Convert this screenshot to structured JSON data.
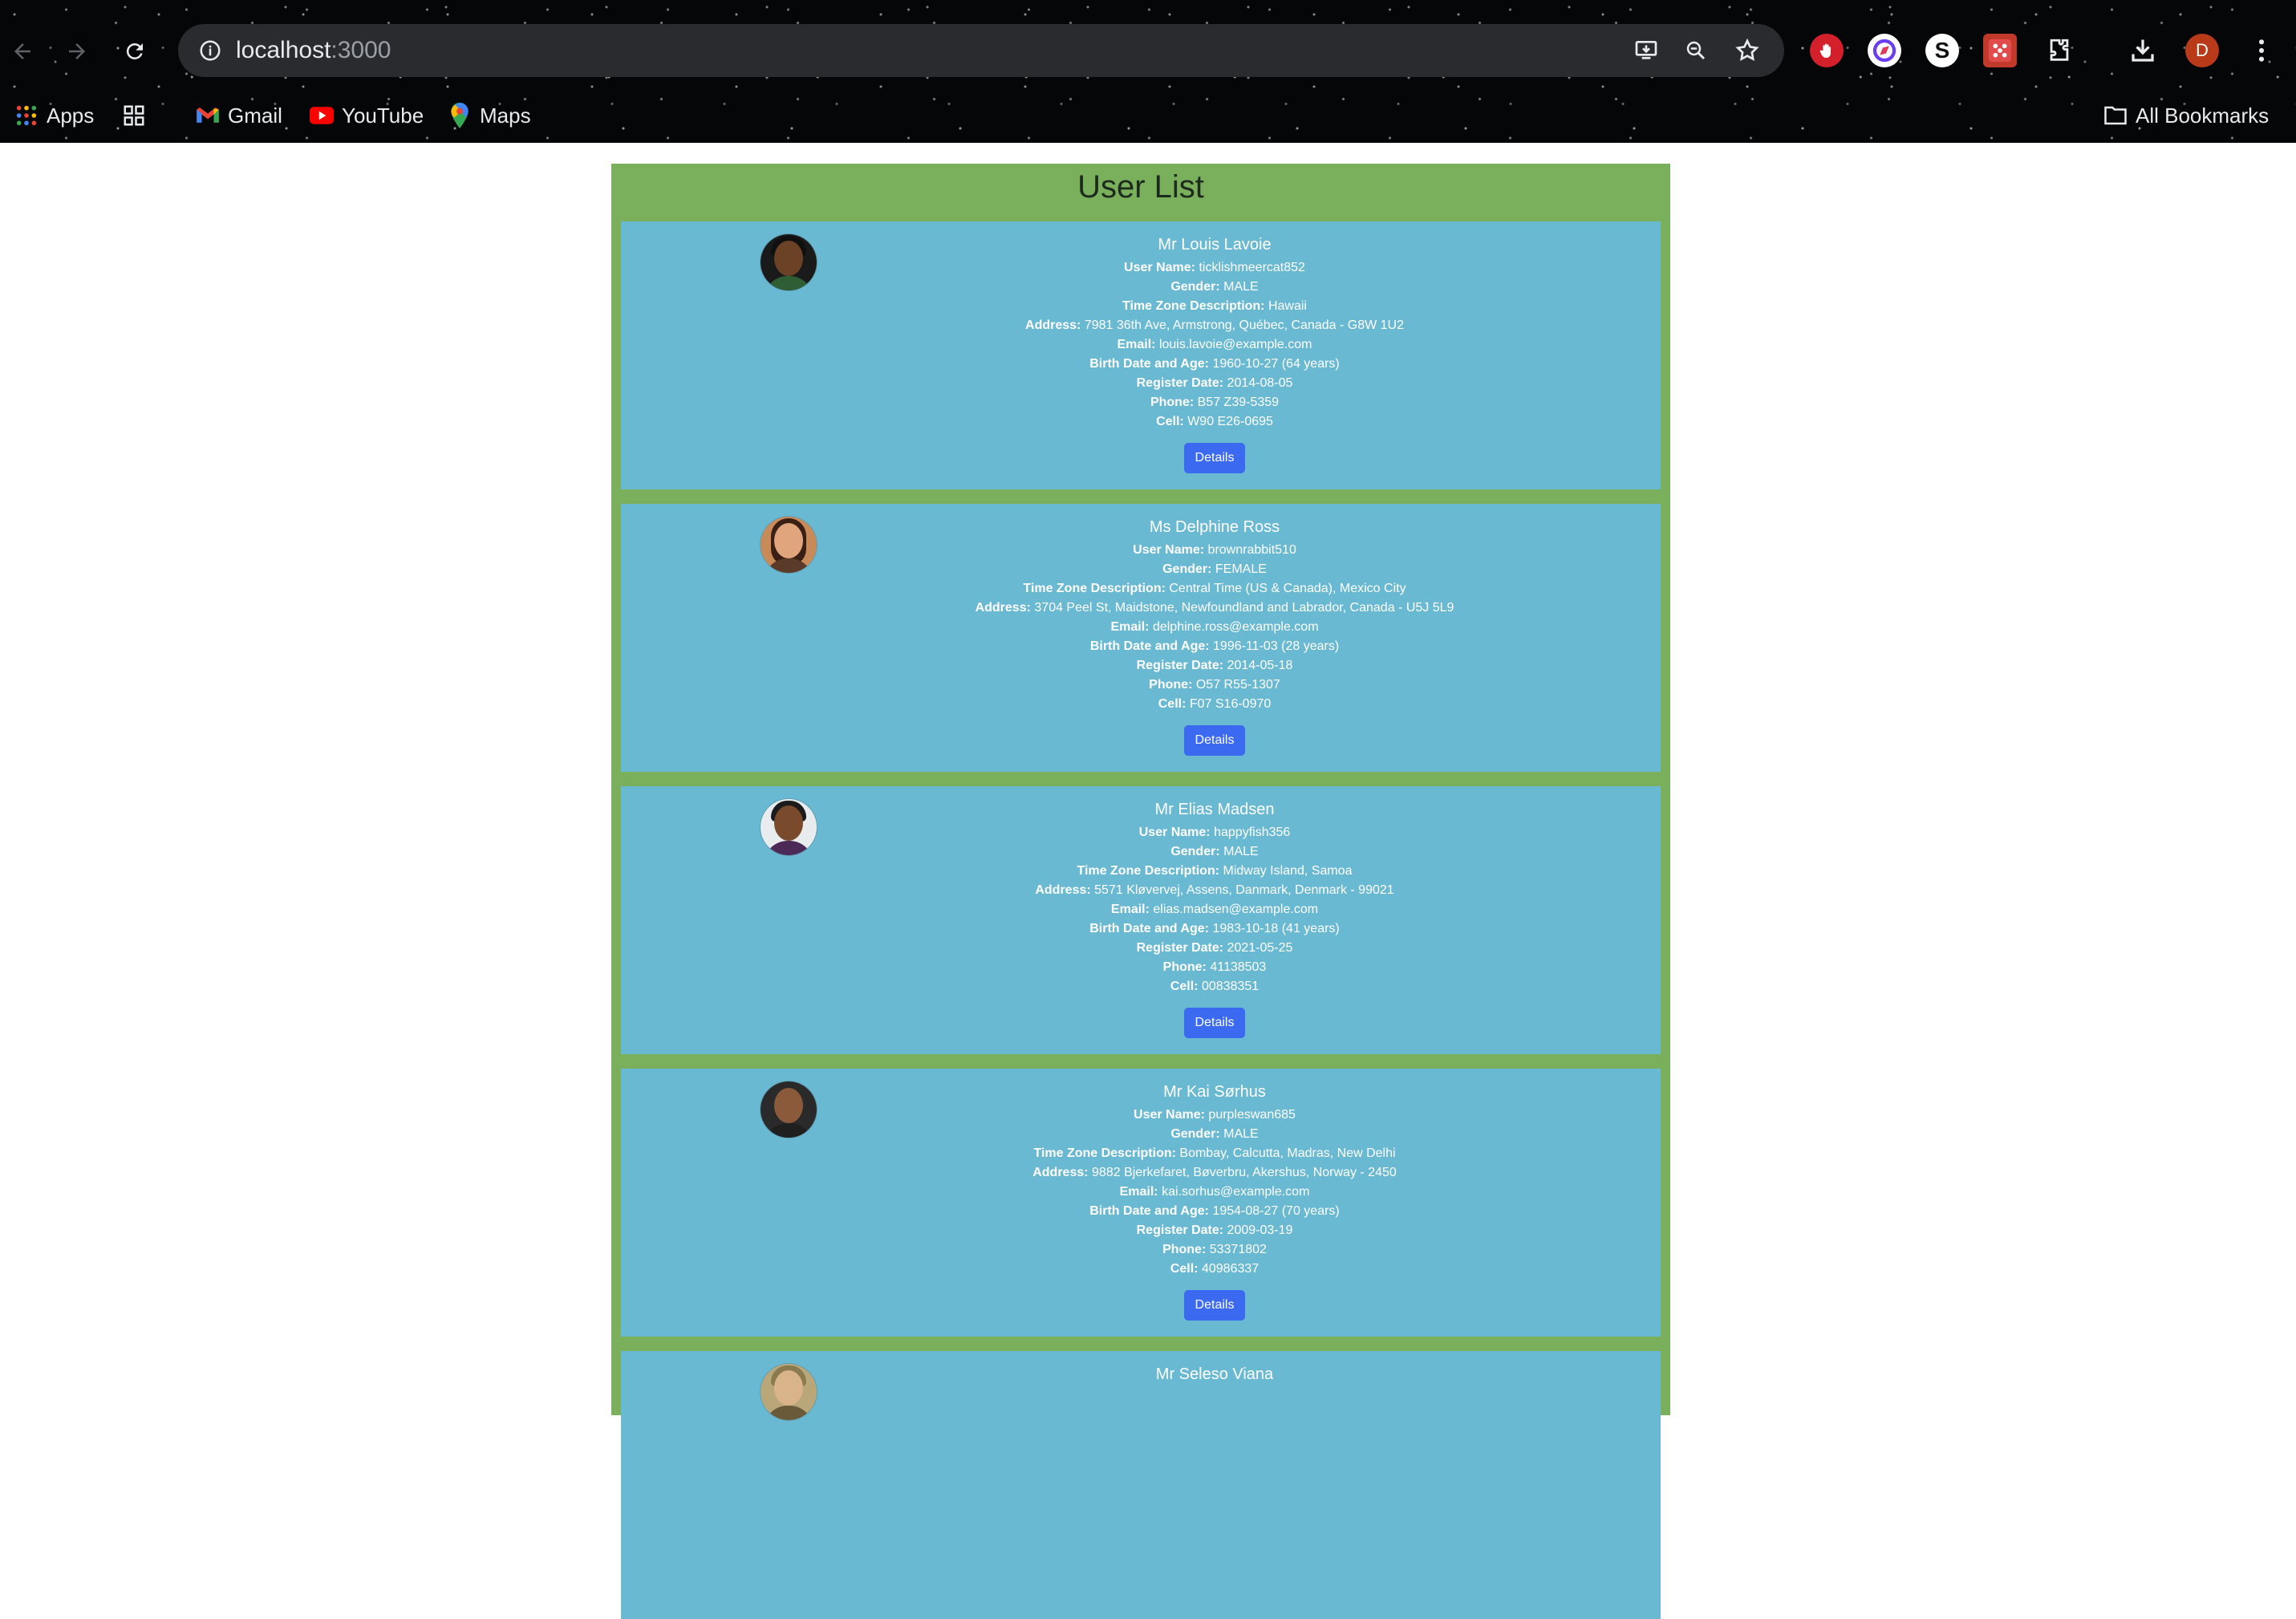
{
  "browser": {
    "url_host": "localhost",
    "url_port": ":3000",
    "profile_initial": "D",
    "bookmarks": {
      "apps": "Apps",
      "gmail": "Gmail",
      "youtube": "YouTube",
      "maps": "Maps",
      "all_bookmarks": "All Bookmarks"
    }
  },
  "page": {
    "title": "User List",
    "details_label": "Details",
    "labels": {
      "username": "User Name:",
      "gender": "Gender:",
      "timezone": "Time Zone Description:",
      "address": "Address:",
      "email": "Email:",
      "birth": "Birth Date and Age:",
      "register": "Register Date:",
      "phone": "Phone:",
      "cell": "Cell:"
    }
  },
  "users": [
    {
      "name": "Mr Louis Lavoie",
      "username": "ticklishmeercat852",
      "gender": "MALE",
      "timezone": "Hawaii",
      "address": "7981 36th Ave, Armstrong, Québec, Canada - G8W 1U2",
      "email": "louis.lavoie@example.com",
      "birth": "1960-10-27 (64 years)",
      "register": "2014-08-05",
      "phone": "B57 Z39-5359",
      "cell": "W90 E26-0695"
    },
    {
      "name": "Ms Delphine Ross",
      "username": "brownrabbit510",
      "gender": "FEMALE",
      "timezone": "Central Time (US & Canada), Mexico City",
      "address": "3704 Peel St, Maidstone, Newfoundland and Labrador, Canada - U5J 5L9",
      "email": "delphine.ross@example.com",
      "birth": "1996-11-03 (28 years)",
      "register": "2014-05-18",
      "phone": "O57 R55-1307",
      "cell": "F07 S16-0970"
    },
    {
      "name": "Mr Elias Madsen",
      "username": "happyfish356",
      "gender": "MALE",
      "timezone": "Midway Island, Samoa",
      "address": "5571 Kløvervej, Assens, Danmark, Denmark - 99021",
      "email": "elias.madsen@example.com",
      "birth": "1983-10-18 (41 years)",
      "register": "2021-05-25",
      "phone": "41138503",
      "cell": "00838351"
    },
    {
      "name": "Mr Kai Sørhus",
      "username": "purpleswan685",
      "gender": "MALE",
      "timezone": "Bombay, Calcutta, Madras, New Delhi",
      "address": "9882 Bjerkefaret, Bøverbru, Akershus, Norway - 2450",
      "email": "kai.sorhus@example.com",
      "birth": "1954-08-27 (70 years)",
      "register": "2009-03-19",
      "phone": "53371802",
      "cell": "40986337"
    },
    {
      "name": "Mr Seleso Viana"
    }
  ]
}
